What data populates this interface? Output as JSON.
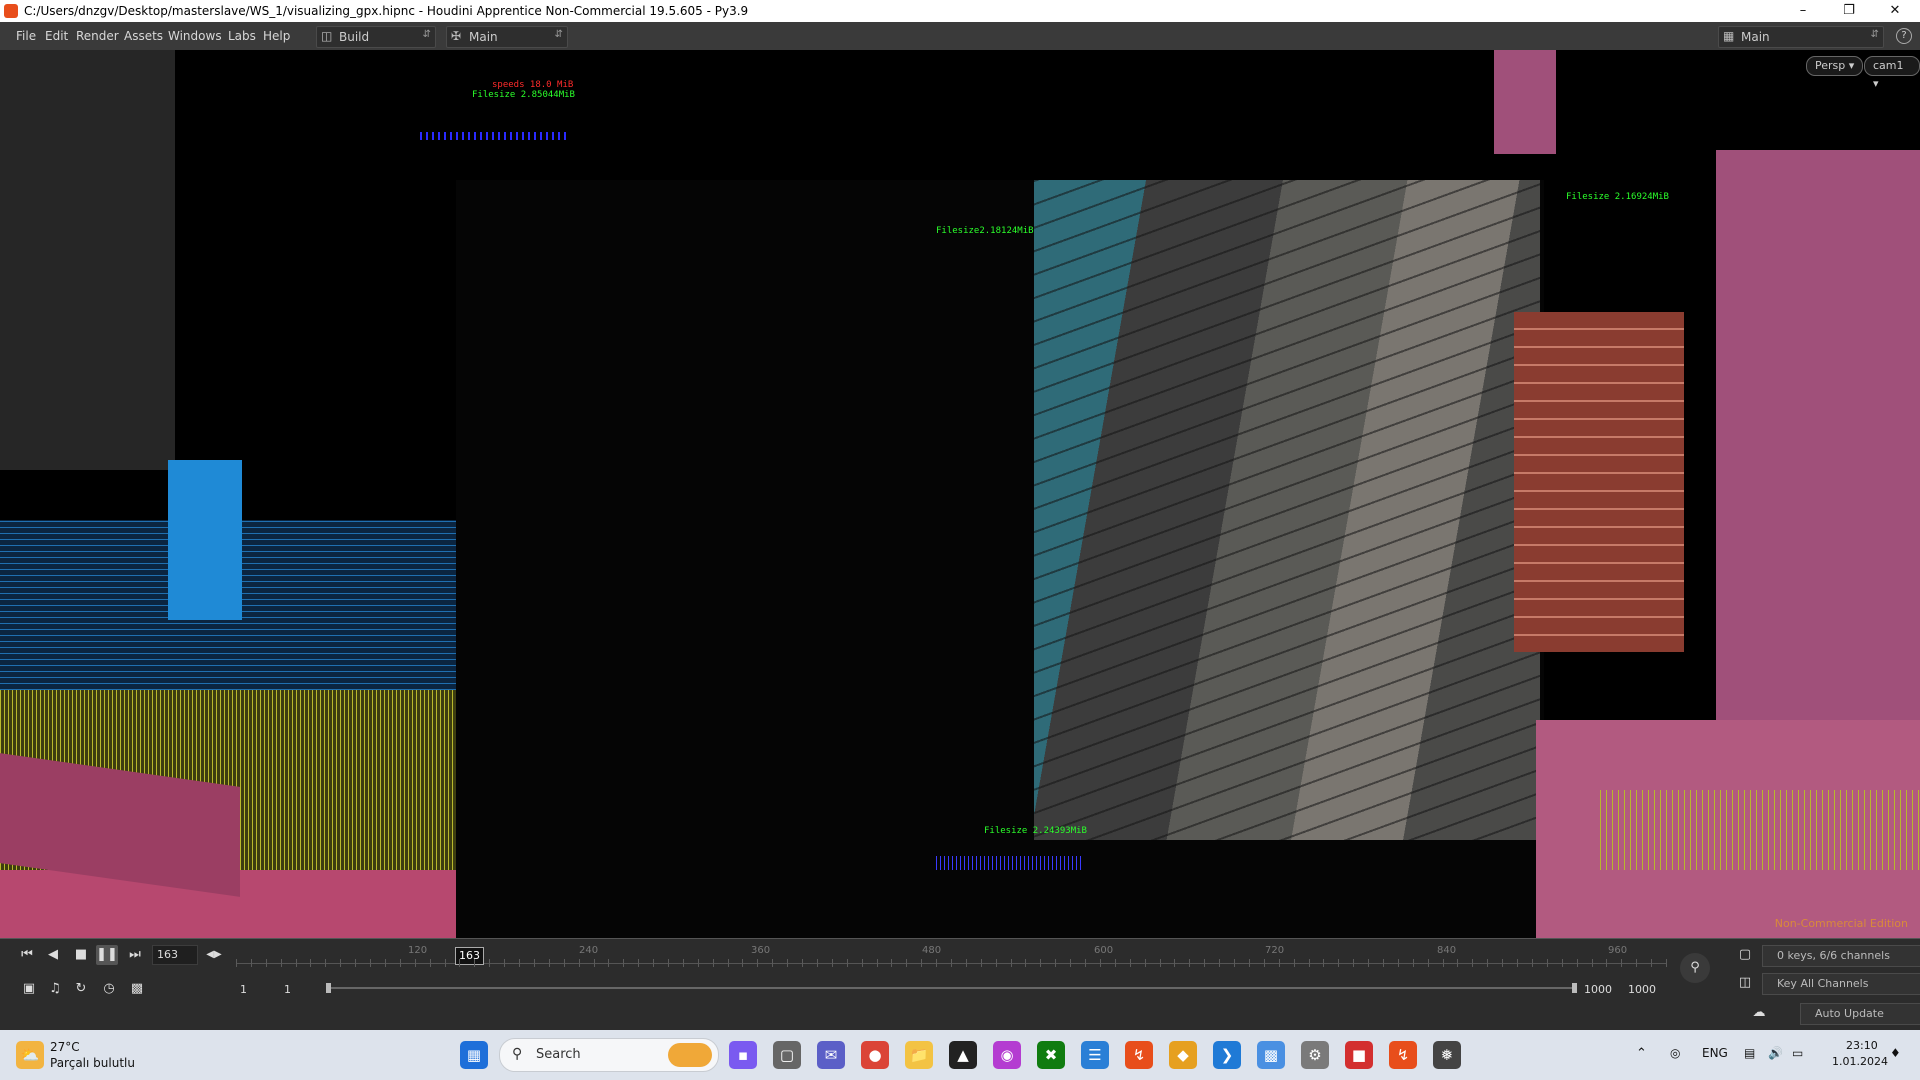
{
  "window": {
    "title": "C:/Users/dnzgv/Desktop/masterslave/WS_1/visualizing_gpx.hipnc - Houdini Apprentice Non-Commercial 19.5.605 - Py3.9",
    "minimize": "–",
    "restore": "❐",
    "close": "✕"
  },
  "menubar": {
    "items": [
      "File",
      "Edit",
      "Render",
      "Assets",
      "Windows",
      "Labs",
      "Help"
    ],
    "desktop_build": "Build",
    "desktop_main": "Main",
    "desktop_right": "Main",
    "help_icon": "?"
  },
  "viewport": {
    "persp_button": "Persp ▾",
    "cam_button": "cam1 ▾",
    "non_commercial": "Non-Commercial Edition",
    "overlays": [
      {
        "text": "Filesize  2.85044MiB",
        "color": "#2bff2b"
      },
      {
        "text": "speeds  18.0 MiB",
        "color": "#ff2b2b"
      },
      {
        "text": "Filesize2.18124MiB",
        "color": "#2bff2b"
      },
      {
        "text": "Filesize 2.16924MiB",
        "color": "#2bff2b"
      },
      {
        "text": "Filesize 2.24393MiB",
        "color": "#2bff2b"
      }
    ]
  },
  "playbar": {
    "current_frame": "163",
    "marker_frame": "163",
    "tick_labels": [
      "120",
      "240",
      "360",
      "480",
      "600",
      "720",
      "840",
      "960"
    ],
    "range_start": "1",
    "range_start2": "1",
    "range_end": "1000",
    "range_end2": "1000",
    "keys_channels": "0 keys, 6/6 channels",
    "key_all_channels": "Key All Channels",
    "auto_update": "Auto Update"
  },
  "taskbar": {
    "weather_temp": "27°C",
    "weather_desc": "Parçalı bulutlu",
    "search_placeholder": "Search",
    "language": "ENG",
    "time": "23:10",
    "date": "1.01.2024"
  },
  "colors": {
    "viewport_bg": "#000000",
    "building_blue": "#1f8ad6",
    "ground_pink": "#c8507e",
    "yellow_mesh": "#b8b82c",
    "houdini_orange": "#e84e1b"
  }
}
